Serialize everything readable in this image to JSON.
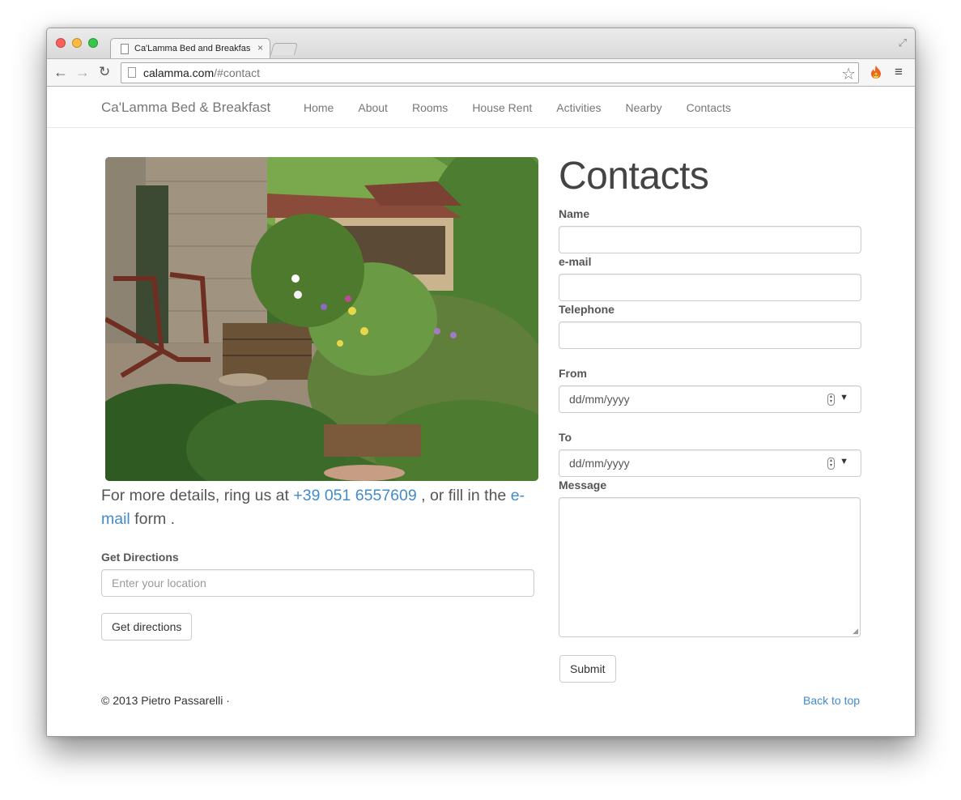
{
  "browser": {
    "tab_title": "Ca'Lamma Bed and Breakfast",
    "url_host": "calamma.com",
    "url_path": "/#contact",
    "tab_close": "×",
    "back_icon": "←",
    "forward_icon": "→",
    "reload_icon": "↻",
    "star_icon": "☆",
    "menu_icon": "≡",
    "fullscreen_icon": "⤢"
  },
  "navbar": {
    "brand": "Ca'Lamma Bed & Breakfast",
    "links": [
      "Home",
      "About",
      "Rooms",
      "House Rent",
      "Activities",
      "Nearby",
      "Contacts"
    ]
  },
  "left": {
    "intro_prefix": "For more details, ring us at ",
    "phone": "+39 051 6557609",
    "intro_middle": " , or fill in the ",
    "email_link": "e-mail",
    "intro_suffix": " form .",
    "directions_label": "Get Directions",
    "directions_placeholder": "Enter your location",
    "directions_button": "Get directions"
  },
  "contact_form": {
    "heading": "Contacts",
    "name_label": "Name",
    "email_label": "e-mail",
    "telephone_label": "Telephone",
    "from_label": "From",
    "from_value": "dd/mm/yyyy",
    "to_label": "To",
    "to_value": "dd/mm/yyyy",
    "message_label": "Message",
    "submit_label": "Submit"
  },
  "footer": {
    "copyright": "© 2013 Pietro Passarelli ·",
    "back_to_top": "Back to top"
  },
  "colors": {
    "link": "#428bca",
    "nav_text": "#777777",
    "heading": "#444444"
  }
}
